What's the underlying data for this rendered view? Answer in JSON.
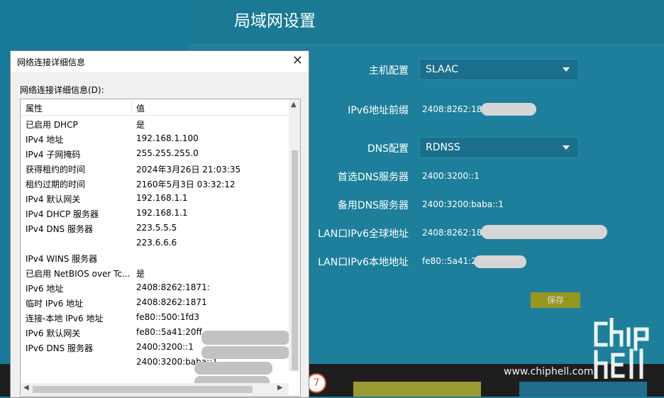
{
  "router": {
    "title": "局域网设置",
    "fields": {
      "host_config_label": "主机配置",
      "host_config_value": "SLAAC",
      "prefix_label": "IPv6地址前缀",
      "prefix_value": "2408:8262:187",
      "dns_config_label": "DNS配置",
      "dns_config_value": "RDNSS",
      "primary_dns_label": "首选DNS服务器",
      "primary_dns_value": "2400:3200::1",
      "secondary_dns_label": "备用DNS服务器",
      "secondary_dns_value": "2400:3200:baba::1",
      "lan_global_label": "LAN口IPv6全球地址",
      "lan_global_value": "2408:8262:187",
      "lan_local_label": "LAN口IPv6本地地址",
      "lan_local_value": "fe80::5a41:20"
    },
    "save_label": "保存",
    "bottom_circle": "7"
  },
  "dialog": {
    "title": "网络连接详细信息",
    "list_label": "网络连接详细信息(D):",
    "columns": {
      "property": "属性",
      "value": "值"
    },
    "rows": [
      {
        "k": "已启用 DHCP",
        "v": "是"
      },
      {
        "k": "IPv4 地址",
        "v": "192.168.1.100"
      },
      {
        "k": "IPv4 子网掩码",
        "v": "255.255.255.0"
      },
      {
        "k": "获得租约的时间",
        "v": "2024年3月26日 21:03:35"
      },
      {
        "k": "租约过期的时间",
        "v": "2160年5月3日 03:32:12"
      },
      {
        "k": "IPv4 默认网关",
        "v": "192.168.1.1"
      },
      {
        "k": "IPv4 DHCP 服务器",
        "v": "192.168.1.1"
      },
      {
        "k": "IPv4 DNS 服务器",
        "v": "223.5.5.5"
      },
      {
        "k": "",
        "v": "223.6.6.6"
      },
      {
        "k": "IPv4 WINS 服务器",
        "v": ""
      },
      {
        "k": "已启用 NetBIOS over Tc...",
        "v": "是"
      },
      {
        "k": "IPv6 地址",
        "v": "2408:8262:1871:"
      },
      {
        "k": "临时 IPv6 地址",
        "v": "2408:8262:1871"
      },
      {
        "k": "连接-本地 IPv6 地址",
        "v": "fe80::500:1fd3"
      },
      {
        "k": "IPv6 默认网关",
        "v": "fe80::5a41:20ff"
      },
      {
        "k": "IPv6 DNS 服务器",
        "v": "2400:3200::1"
      },
      {
        "k": "",
        "v": "2400:3200:baba::1"
      }
    ]
  },
  "watermark": "www.chiphell.com",
  "logo_text": "chip hell",
  "icons": {
    "close": "close-icon",
    "dropdown": "chevron-down-icon",
    "scroll_up": "arrow-up-icon",
    "scroll_left": "arrow-left-icon",
    "scroll_right": "arrow-right-icon"
  },
  "colors": {
    "page_bg": "#1b7d99",
    "save_button": "#97961e",
    "select_bg": "#1b6f8c"
  }
}
